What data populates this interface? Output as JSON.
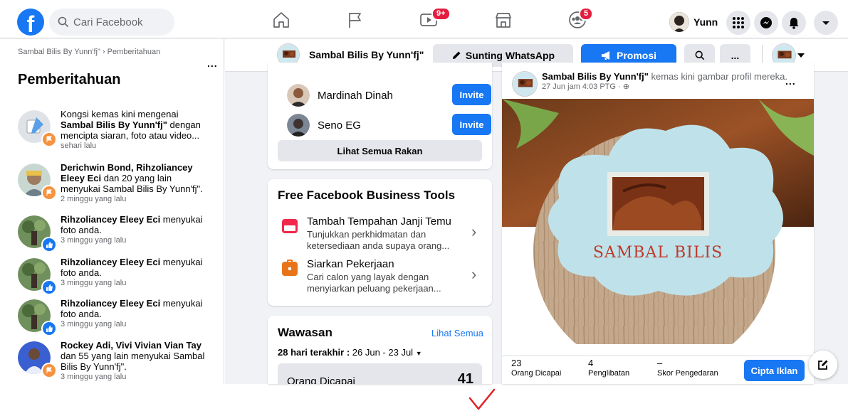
{
  "topbar": {
    "logo_letter": "f",
    "search_placeholder": "Cari Facebook",
    "nav": [
      {
        "name": "home-icon"
      },
      {
        "name": "pages-flag-icon"
      },
      {
        "name": "watch-icon",
        "badge": "9+"
      },
      {
        "name": "marketplace-icon"
      },
      {
        "name": "groups-icon",
        "badge": "5"
      }
    ],
    "user_name": "Yunn",
    "badge_color": "#e41e3f",
    "accent_color": "#1877f2"
  },
  "left": {
    "breadcrumb": "Sambal Bilis By Yunn'fj\" › Pemberitahuan",
    "more": "...",
    "title": "Pemberitahuan",
    "notifications": [
      {
        "prefix": "Kongsi kemas kini mengenai ",
        "bold": "Sambal Bilis By Yunn'fj\"",
        "suffix": " dengan mencipta siaran, foto atau video...",
        "time": "sehari lalu",
        "badge": "flag-icon"
      },
      {
        "prefix": "",
        "bold": "Derichwin Bond, Rihzoliancey Eleey Eci",
        "suffix": " dan 20 yang lain menyukai Sambal Bilis By Yunn'fj\".",
        "time": "2 minggu yang lalu",
        "badge": "flag-icon"
      },
      {
        "prefix": "",
        "bold": "Rihzoliancey Eleey Eci",
        "suffix": " menyukai foto anda.",
        "time": "3 minggu yang lalu",
        "badge": "thumbs-up-icon"
      },
      {
        "prefix": "",
        "bold": "Rihzoliancey Eleey Eci",
        "suffix": " menyukai foto anda.",
        "time": "3 minggu yang lalu",
        "badge": "thumbs-up-icon"
      },
      {
        "prefix": "",
        "bold": "Rihzoliancey Eleey Eci",
        "suffix": " menyukai foto anda.",
        "time": "3 minggu yang lalu",
        "badge": "thumbs-up-icon"
      },
      {
        "prefix": "",
        "bold": "Rockey Adi, Vivi Vivian Vian Tay",
        "suffix": " dan 55 yang lain menyukai Sambal Bilis By Yunn'fj\".",
        "time": "3 minggu yang lalu",
        "badge": "flag-icon"
      }
    ]
  },
  "page_bar": {
    "page_name": "Sambal Bilis By Yunn'fj\"",
    "edit_whatsapp": "Sunting WhatsApp",
    "promote": "Promosi",
    "more": "..."
  },
  "friends": {
    "items": [
      {
        "name": "Mardinah Dinah",
        "action": "Invite"
      },
      {
        "name": "Seno EG",
        "action": "Invite"
      }
    ],
    "see_all": "Lihat Semua Rakan"
  },
  "tools": {
    "title": "Free Facebook Business Tools",
    "items": [
      {
        "name": "Tambah Tempahan Janji Temu",
        "desc": "Tunjukkan perkhidmatan dan ketersediaan anda supaya orang..."
      },
      {
        "name": "Siarkan Pekerjaan",
        "desc": "Cari calon yang layak dengan menyiarkan peluang pekerjaan..."
      }
    ]
  },
  "insights": {
    "title": "Wawasan",
    "see_all": "Lihat Semua",
    "range_label": "28 hari terakhir : ",
    "range_value": "26 Jun - 23 Jul",
    "metric_label": "Orang Dicapai",
    "metric_value": "41"
  },
  "post": {
    "author": "Sambal Bilis By Yunn'fj\"",
    "action": " kemas kini gambar profil mereka.",
    "time": "27 Jun jam 4:03 PTG · ",
    "more": "...",
    "image_text": "SAMBAL BILIS",
    "stats": [
      {
        "value": "23",
        "label": "Orang Dicapai"
      },
      {
        "value": "4",
        "label": "Penglibatan"
      },
      {
        "value": "–",
        "label": "Skor Pengedaran"
      }
    ],
    "cta": "Cipta Iklan"
  }
}
